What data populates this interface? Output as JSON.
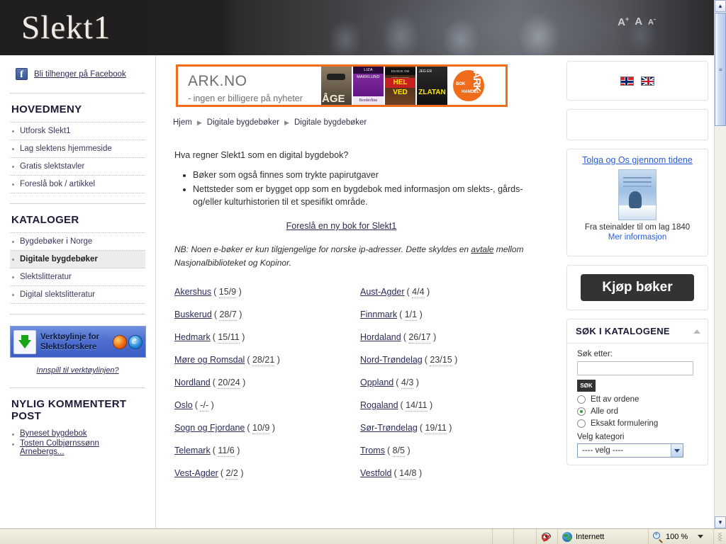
{
  "header": {
    "logo_text": "Slekt1",
    "font_increase": "A",
    "font_normal": "A",
    "font_decrease": "A",
    "font_increase_sup": "+",
    "font_decrease_sup": "-"
  },
  "left_sidebar": {
    "facebook_link": "Bli tilhenger på Facebook",
    "facebook_icon_letter": "f",
    "hovedmeny_title": "HOVEDMENY",
    "hovedmeny_items": [
      {
        "label": "Utforsk Slekt1"
      },
      {
        "label": "Lag slektens hjemmeside"
      },
      {
        "label": "Gratis slektstavler"
      },
      {
        "label": "Foreslå bok / artikkel"
      }
    ],
    "kataloger_title": "KATALOGER",
    "kataloger_items": [
      {
        "label": "Bygdebøker i Norge",
        "active": false
      },
      {
        "label": "Digitale bygdebøker",
        "active": true
      },
      {
        "label": "Slektslitteratur",
        "active": false
      },
      {
        "label": "Digital slektslitteratur",
        "active": false
      }
    ],
    "toolbar_line1": "Verktøylinje for",
    "toolbar_line2": "Slektsforskere",
    "toolbar_note": "Innspill til verktøylinjen?",
    "nylig_title": "NYLIG KOMMENTERT POST",
    "nylig_items": [
      {
        "label": "Byneset bygdebok"
      },
      {
        "label": "Tosten Colbjørnssønn Arnebergs..."
      }
    ]
  },
  "main": {
    "ark_banner": {
      "title": "ARK.NO",
      "subtitle": "- ingen er billigere på nyheter",
      "covers": [
        {
          "name": "ÅGE"
        },
        {
          "name": "LIZA MARKLUND",
          "sub": "Borderline"
        },
        {
          "name": "HEL VED",
          "top": "EN BOK OM VEDHOGST"
        },
        {
          "name": "ZLATAN",
          "top": "JEG ER"
        }
      ],
      "logo_big": "ARK",
      "logo_s1": "BOK",
      "logo_s2": "HANDEL",
      "border_color": "#ef6c1a"
    },
    "breadcrumb": [
      {
        "label": "Hjem"
      },
      {
        "label": "Digitale bygdebøker"
      },
      {
        "label": "Digitale bygdebøker"
      }
    ],
    "question": "Hva regner Slekt1 som en digital bygdebok?",
    "bullets": [
      "Bøker som også finnes som trykte papirutgaver",
      "Nettsteder som er bygget opp som en bygdebok med informasjon om slekts-, gårds- og/eller kulturhistorien til et spesifikt område."
    ],
    "suggest_link": "Foreslå en ny bok for Slekt1",
    "nb_prefix": "NB: Noen e-bøker er kun tilgjengelige for norske ip-adresser. Dette skyldes en ",
    "nb_link": "avtale",
    "nb_suffix": " mellom Nasjonalbiblioteket og Kopinor.",
    "counties_left": [
      {
        "name": "Akershus",
        "count": "15/9"
      },
      {
        "name": "Buskerud",
        "count": "28/7"
      },
      {
        "name": "Hedmark",
        "count": "15/11"
      },
      {
        "name": "Møre og Romsdal",
        "count": "28/21"
      },
      {
        "name": "Nordland",
        "count": "20/24"
      },
      {
        "name": "Oslo",
        "count": "-/-"
      },
      {
        "name": "Sogn og Fjordane",
        "count": "10/9"
      },
      {
        "name": "Telemark",
        "count": "11/6"
      },
      {
        "name": "Vest-Agder",
        "count": "2/2"
      }
    ],
    "counties_right": [
      {
        "name": "Aust-Agder",
        "count": "4/4"
      },
      {
        "name": "Finnmark",
        "count": "1/1"
      },
      {
        "name": "Hordaland",
        "count": "26/17"
      },
      {
        "name": "Nord-Trøndelag",
        "count": "23/15"
      },
      {
        "name": "Oppland",
        "count": "4/3"
      },
      {
        "name": "Rogaland",
        "count": "14/11"
      },
      {
        "name": "Sør-Trøndelag",
        "count": "19/11"
      },
      {
        "name": "Troms",
        "count": "8/5"
      },
      {
        "name": "Vestfold",
        "count": "14/8"
      }
    ]
  },
  "right_sidebar": {
    "book_promo": {
      "title": "Tolga og Os gjennom tidene",
      "caption": "Fra steinalder til om lag 1840",
      "more_link": "Mer informasjon"
    },
    "buy_button": "Kjøp bøker",
    "search": {
      "title": "SØK I KATALOGENE",
      "label": "Søk etter:",
      "value": "",
      "placeholder": "",
      "button": "SØK",
      "options": [
        {
          "label": "Ett av ordene",
          "selected": false
        },
        {
          "label": "Alle ord",
          "selected": true
        },
        {
          "label": "Eksakt formulering",
          "selected": false
        }
      ],
      "category_label": "Velg kategori",
      "category_value": "---- velg ----"
    }
  },
  "statusbar": {
    "message": "",
    "zone": "Internett",
    "zoom": "100 %"
  }
}
